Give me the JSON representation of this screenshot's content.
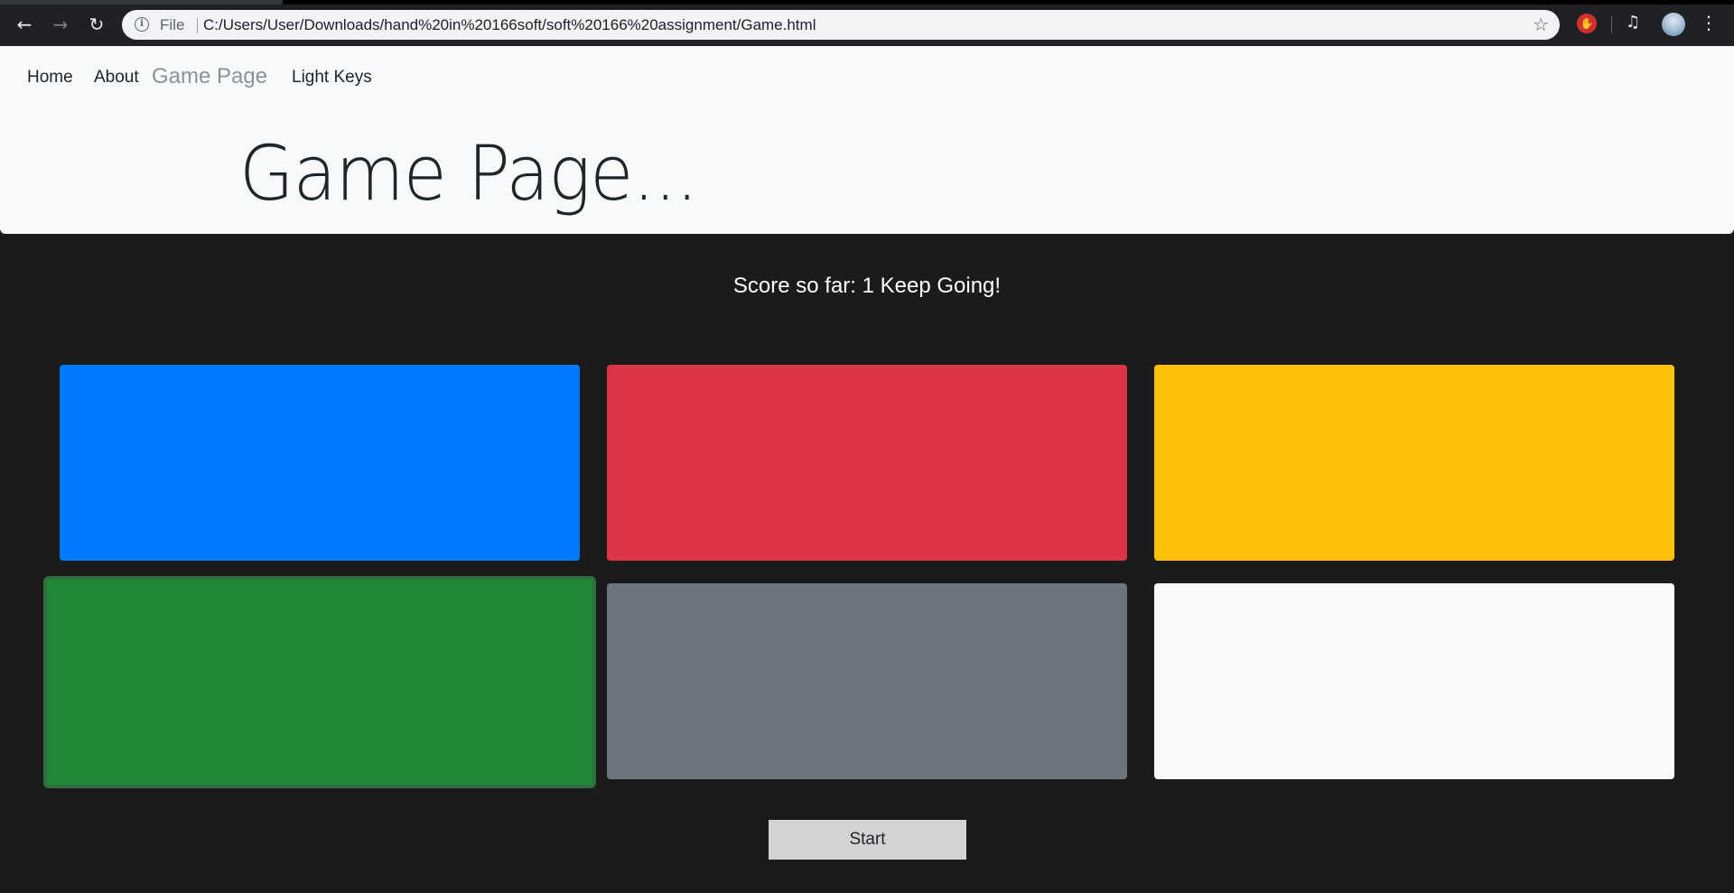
{
  "browser": {
    "url_scheme": "File",
    "url": "C:/Users/User/Downloads/hand%20in%20166soft/soft%20166%20assignment/Game.html",
    "icons": {
      "back": "back-arrow-icon",
      "forward": "forward-arrow-icon",
      "reload": "reload-icon",
      "info": "info-icon",
      "bookmark": "star-icon",
      "extension": "stop-hand-icon",
      "media": "media-queue-icon",
      "profile": "profile-avatar",
      "menu": "more-vertical-icon"
    }
  },
  "navbar": {
    "links": [
      {
        "label": "Home"
      },
      {
        "label": "About"
      },
      {
        "label": "Game Page",
        "active": true
      },
      {
        "label": "Light Keys"
      }
    ]
  },
  "header": {
    "title": "Game Page..."
  },
  "game": {
    "score_text": "Score so far: 1 Keep Going!",
    "tiles": [
      {
        "color": "#007bff",
        "name": "blue"
      },
      {
        "color": "#dc3545",
        "name": "red"
      },
      {
        "color": "#ffc107",
        "name": "yellow"
      },
      {
        "color": "#218838",
        "name": "green",
        "highlighted": true
      },
      {
        "color": "#6c757d",
        "name": "gray"
      },
      {
        "color": "#f8f9fa",
        "name": "white"
      }
    ],
    "start_label": "Start"
  },
  "colors": {
    "page_bg": "#1b1b1b",
    "header_bg": "#f8f9fa",
    "button_bg": "#d3d3d3"
  }
}
